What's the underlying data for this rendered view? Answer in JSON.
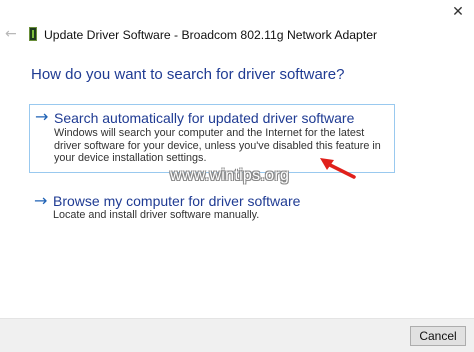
{
  "window": {
    "close_glyph": "✕",
    "title": "Update Driver Software - Broadcom 802.11g Network Adapter",
    "back_glyph": "←",
    "device_icon": "network-adapter-icon"
  },
  "heading": "How do you want to search for driver software?",
  "options": [
    {
      "arrow": "→",
      "title": "Search automatically for updated driver software",
      "description": "Windows will search your computer and the Internet for the latest driver software for your device, unless you've disabled this feature in your device installation settings.",
      "selected": true
    },
    {
      "arrow": "→",
      "title": "Browse my computer for driver software",
      "description": "Locate and install driver software manually.",
      "selected": false
    }
  ],
  "watermark": "www.wintips.org",
  "annotation_color": "#e0201b",
  "footer": {
    "cancel_label": "Cancel"
  },
  "colors": {
    "heading": "#1f3b93",
    "arrow": "#1f62b5",
    "selection_border": "#99c9ef"
  }
}
